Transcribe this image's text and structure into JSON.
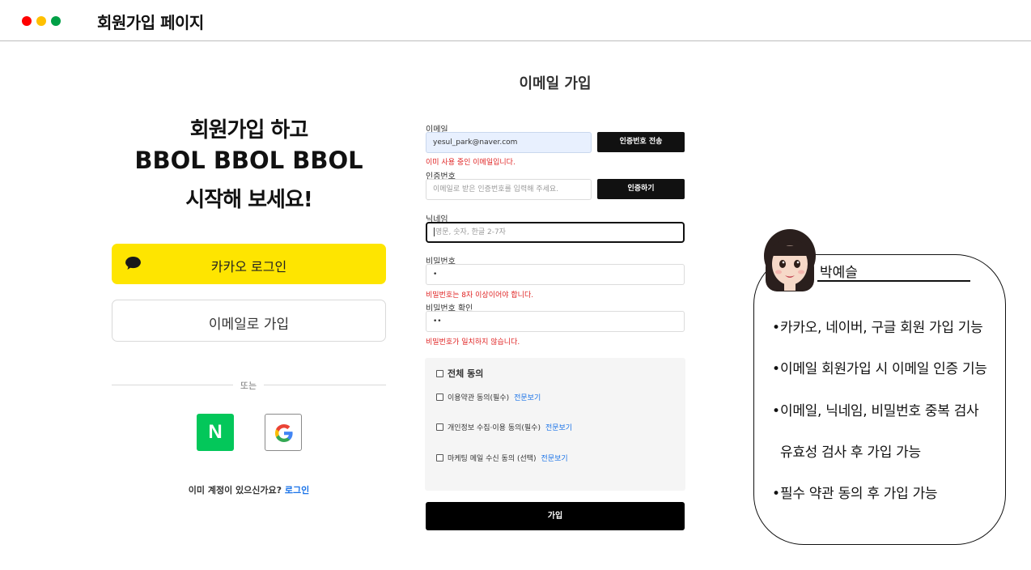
{
  "slide": {
    "title": "회원가입 페이지",
    "window_dot_colors": [
      "#ff0000",
      "#ffc000",
      "#00a046"
    ]
  },
  "promo": {
    "line1": "회원가입 하고",
    "brand": "BBOL BBOL BBOL",
    "line3": "시작해 보세요!"
  },
  "social": {
    "kakao_label": "카카오 로그인",
    "kakao_color": "#fee500",
    "email_join_label": "이메일로 가입",
    "divider_text": "또는",
    "naver_letter": "N",
    "naver_color": "#03c75a",
    "google_icon": "google-g-icon",
    "have_account_text": "이미 계정이 있으신가요?",
    "login_link": "로그인"
  },
  "form": {
    "title": "이메일 가입",
    "email": {
      "label": "이메일",
      "value": "yesul_park@naver.com",
      "button": "인증번호 전송",
      "error": "이미 사용 중인 이메일입니다."
    },
    "verification": {
      "label": "인증번호",
      "placeholder": "이메일로 받은 인증번호를 입력해 주세요.",
      "button": "인증하기"
    },
    "nickname": {
      "label": "닉네임",
      "placeholder": "영문, 숫자, 한글 2-7자"
    },
    "password": {
      "label": "비밀번호",
      "masked_value": "•",
      "error": "비밀번호는 8자 이상이어야 합니다."
    },
    "password_confirm": {
      "label": "비밀번호 확인",
      "masked_value": "••",
      "error": "비밀번호가 일치하지 않습니다."
    },
    "terms": {
      "all": "전체 동의",
      "items": [
        {
          "label": "이용약관 동의(필수)",
          "link": "전문보기"
        },
        {
          "label": "개인정보 수집·이용 동의(필수)",
          "link": "전문보기"
        },
        {
          "label": "마케팅 메일 수신 동의 (선택)",
          "link": "전문보기"
        }
      ]
    },
    "submit": "가입",
    "error_color": "#e02424",
    "link_color": "#1a73e8"
  },
  "note": {
    "presenter": "박예슬",
    "bullet": "•",
    "items": [
      "카카오, 네이버, 구글 회원 가입 기능",
      "이메일 회원가입 시 이메일 인증 기능",
      "이메일, 닉네임, 비밀번호 중복 검사",
      "유효성 검사 후 가입 가능",
      "필수 약관 동의 후 가입 가능"
    ]
  }
}
